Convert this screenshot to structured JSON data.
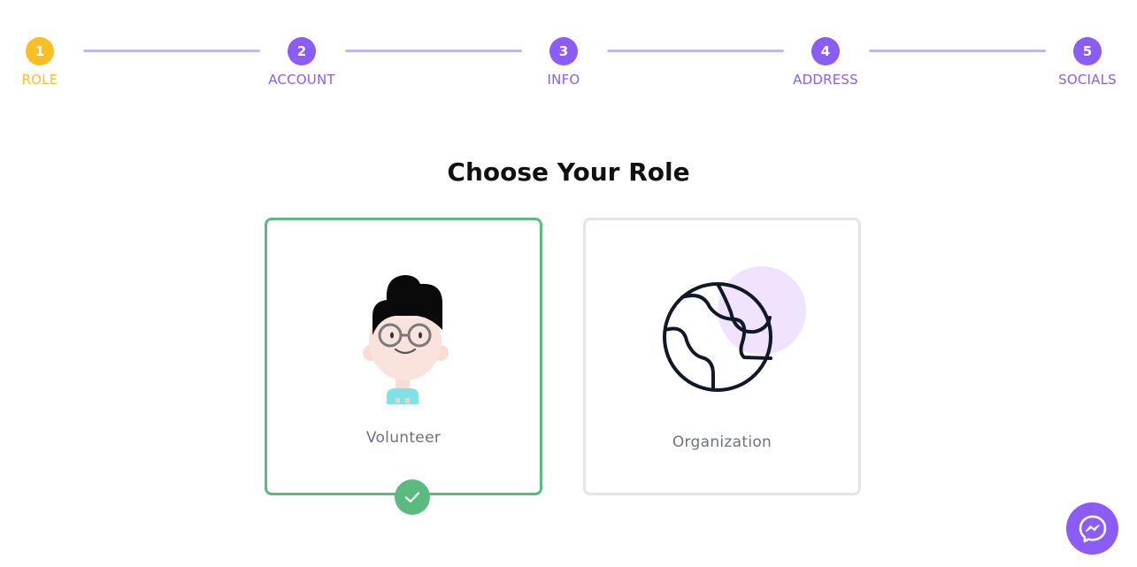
{
  "stepper": {
    "steps": [
      {
        "number": "1",
        "label": "ROLE",
        "state": "active"
      },
      {
        "number": "2",
        "label": "ACCOUNT",
        "state": "pending"
      },
      {
        "number": "3",
        "label": "INFO",
        "state": "pending"
      },
      {
        "number": "4",
        "label": "ADDRESS",
        "state": "pending"
      },
      {
        "number": "5",
        "label": "SOCIALS",
        "state": "pending"
      }
    ]
  },
  "main": {
    "title": "Choose Your Role",
    "roles": [
      {
        "label": "Volunteer",
        "selected": true,
        "icon": "volunteer-avatar-icon"
      },
      {
        "label": "Organization",
        "selected": false,
        "icon": "globe-icon"
      }
    ]
  },
  "colors": {
    "active_step": "#fbbf24",
    "pending_step": "#8b5cf6",
    "connector": "#c4b5fd",
    "selected_border": "#5bba7e",
    "unselected_border": "#e5e5e5"
  },
  "floating": {
    "messenger_icon": "messenger-icon"
  }
}
